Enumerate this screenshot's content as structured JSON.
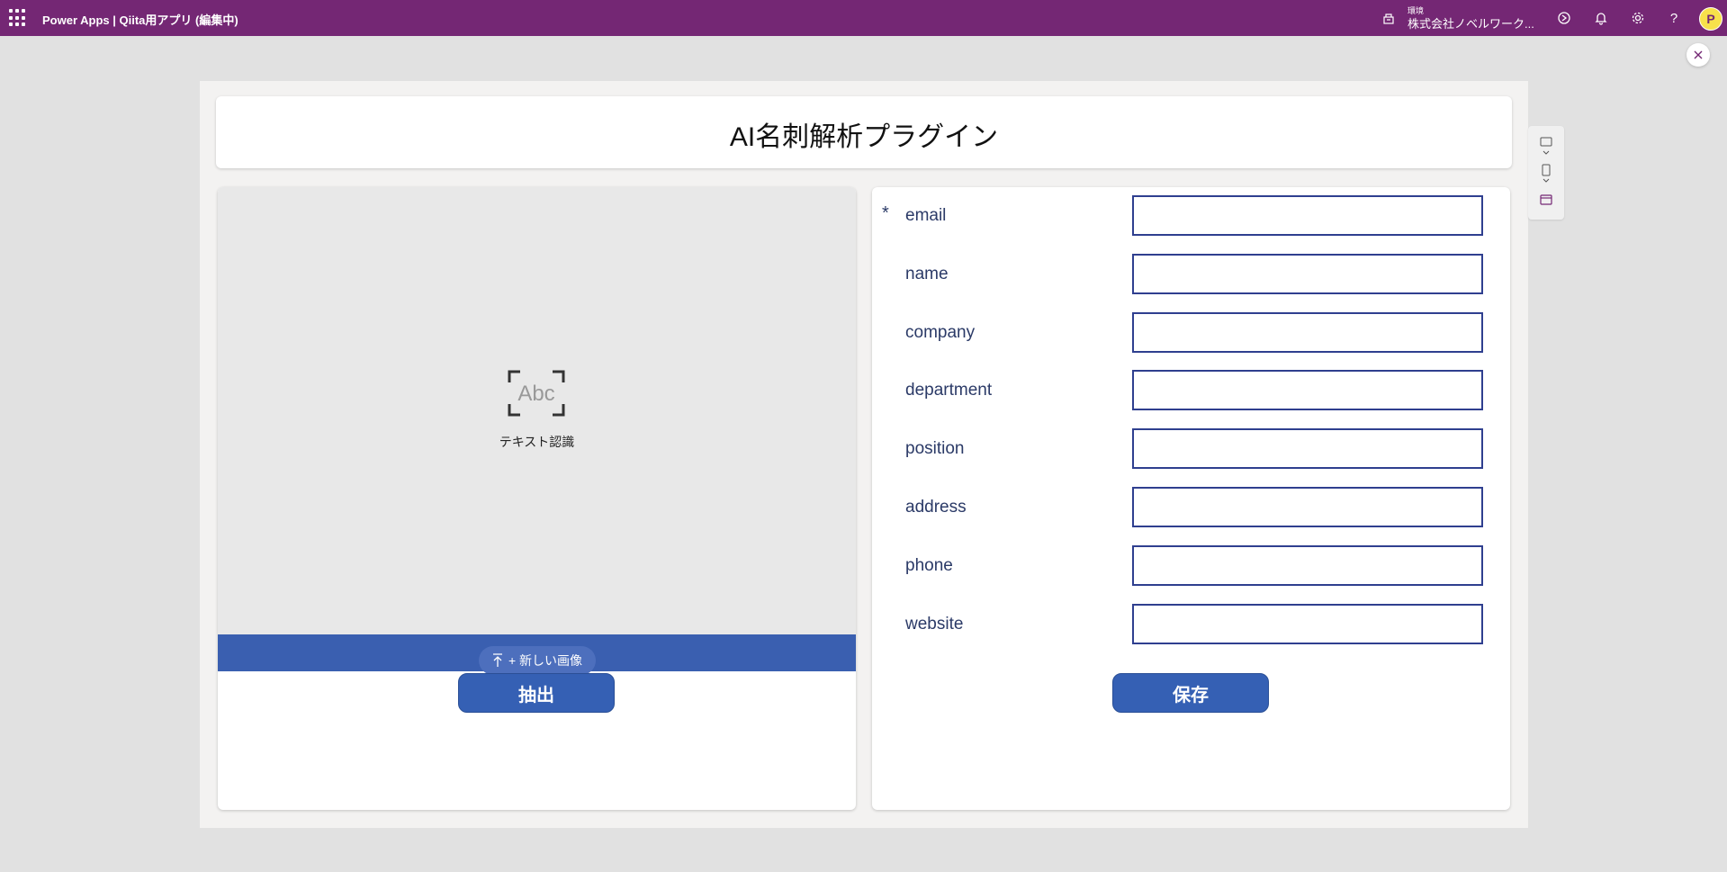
{
  "topbar": {
    "app_title": "Power Apps  |  Qiita用アプリ (編集中)",
    "env_label": "環境",
    "env_name": "株式会社ノベルワーク..."
  },
  "header": {
    "title": "AI名刺解析プラグイン"
  },
  "ocr": {
    "label": "テキスト認識",
    "icon_text": "Abc",
    "upload_label": "+ 新しい画像"
  },
  "buttons": {
    "extract": "抽出",
    "save": "保存"
  },
  "form": {
    "required_marker": "*",
    "fields": [
      {
        "label": "email"
      },
      {
        "label": "name"
      },
      {
        "label": "company"
      },
      {
        "label": "department"
      },
      {
        "label": "position"
      },
      {
        "label": "address"
      },
      {
        "label": "phone"
      },
      {
        "label": "website"
      }
    ]
  },
  "avatar_initial": "P",
  "colors": {
    "topbar": "#742774",
    "button": "#3560b4",
    "upload_bar": "#3a5fb0",
    "field_border": "#2f3f8f",
    "label": "#2b3a67"
  }
}
